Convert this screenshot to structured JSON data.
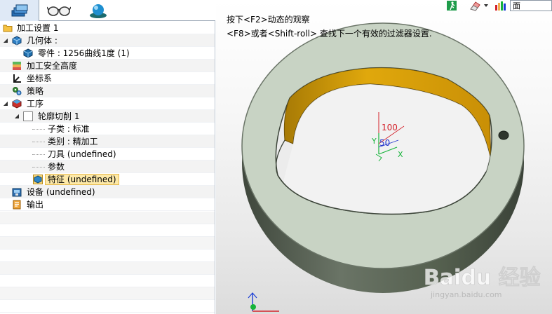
{
  "tabs": [
    {
      "name": "features-tab"
    },
    {
      "name": "view-tab"
    },
    {
      "name": "render-tab"
    }
  ],
  "tree": {
    "root": "加工设置 1",
    "geometry": "几何体 :",
    "part": "零件 : 1256曲线1度 (1)",
    "safe_height": "加工安全高度",
    "coordinate_system": "坐标系",
    "strategy": "策略",
    "process": "工序",
    "contour_cut": "轮廓切削 1",
    "subtype": "子类 : 标准",
    "category": "类别 : 精加工",
    "tool": "刀具 (undefined)",
    "parameters": "参数",
    "feature": "特征 (undefined)",
    "machine": "设备 (undefined)",
    "output": "输出"
  },
  "viewport": {
    "hint_line1": "按下<F2>动态的观察",
    "hint_line2": "<F8>或者<Shift-roll> 查找下一个有效的过滤器设置.",
    "filter_value": "面",
    "axis_labels": {
      "dim1": "100",
      "dim2": "50",
      "x": "X",
      "y": "Y"
    },
    "watermark_text": "Baidu 经验",
    "watermark_url": "jingyan.baidu.com"
  },
  "colors": {
    "ring_top": "#c8d3c4",
    "ring_side": "#505a4c",
    "inner_wall": "#d59a0a",
    "selected_bg": "#fde9a8"
  }
}
